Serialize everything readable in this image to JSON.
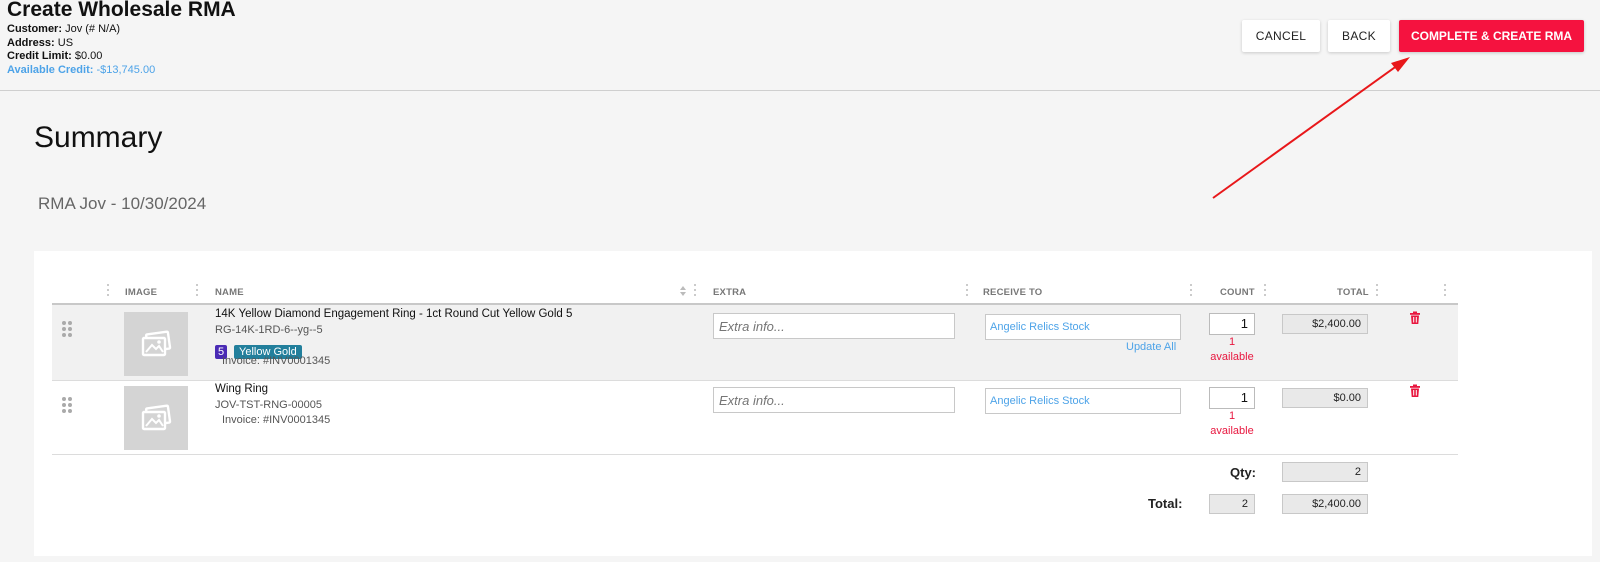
{
  "header": {
    "title": "Create Wholesale RMA",
    "customer_label": "Customer:",
    "customer_value": "Jov (# N/A)",
    "address_label": "Address:",
    "address_value": "US",
    "credit_limit_label": "Credit Limit:",
    "credit_limit_value": "$0.00",
    "available_credit_label": "Available Credit:",
    "available_credit_value": "-$13,745.00",
    "cancel_label": "CANCEL",
    "back_label": "BACK",
    "complete_label": "COMPLETE & CREATE RMA"
  },
  "colors": {
    "accent": "#f5123f",
    "link": "#4da3e8",
    "size_badge": "#4a2bb5",
    "metal_badge": "#227f9c",
    "warning": "#e8173f",
    "arrow": "#e8171a"
  },
  "summary": {
    "title": "Summary",
    "subtitle": "RMA Jov - 10/30/2024"
  },
  "table": {
    "columns": [
      "IMAGE",
      "NAME",
      "EXTRA",
      "RECEIVE TO",
      "COUNT",
      "TOTAL"
    ],
    "rows": [
      {
        "name": "14K Yellow Diamond Engagement Ring - 1ct Round Cut Yellow Gold 5",
        "sku": "RG-14K-1RD-6--yg--5",
        "size_badge": "5",
        "metal_badge": "Yellow Gold",
        "invoice": "Invoice: #INV0001345",
        "extra_placeholder": "Extra info...",
        "receive_to": "Angelic Relics Stock",
        "update_all": "Update All",
        "count": "1",
        "available_count": "1",
        "available_text": "available",
        "total": "$2,400.00"
      },
      {
        "name": "Wing Ring",
        "sku": "JOV-TST-RNG-00005",
        "invoice": "Invoice: #INV0001345",
        "extra_placeholder": "Extra info...",
        "receive_to": "Angelic Relics Stock",
        "count": "1",
        "available_count": "1",
        "available_text": "available",
        "total": "$0.00"
      }
    ],
    "footer": {
      "qty_label": "Qty:",
      "qty_value": "2",
      "total_label": "Total:",
      "total_count": "2",
      "total_value": "$2,400.00"
    }
  },
  "icons": {
    "drag": "drag-handle-icon",
    "image": "image-placeholder-icon",
    "trash": "trash-icon",
    "sort": "sort-icon",
    "column_menu": "column-menu-icon"
  }
}
